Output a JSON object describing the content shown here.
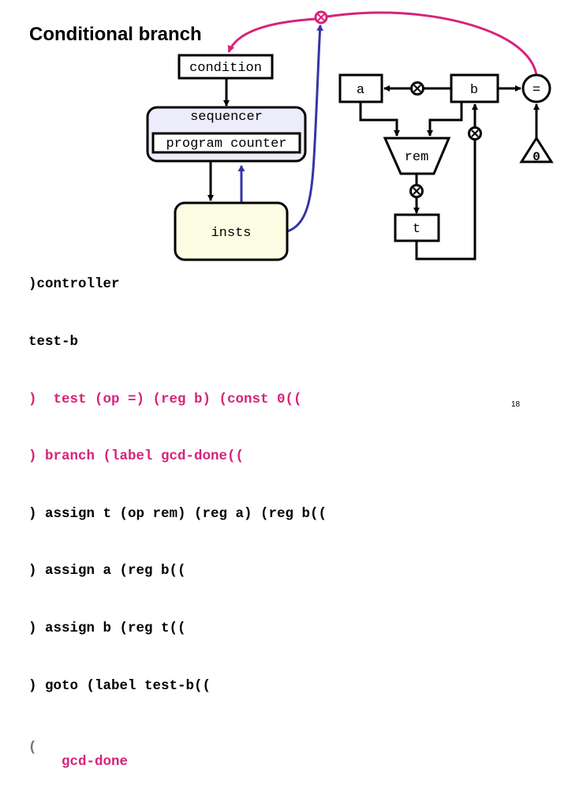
{
  "title": "Conditional branch",
  "diagram": {
    "nodes": {
      "condition": "condition",
      "sequencer": "sequencer",
      "program_counter": "program counter",
      "insts": "insts",
      "reg_a": "a",
      "reg_b": "b",
      "equals_op": "=",
      "rem_op": "rem",
      "reg_t": "t",
      "const_zero": "0"
    },
    "colors": {
      "branch_path": "#d6237a",
      "pc_path": "#3535a8",
      "sequencer_fill": "#ececfb",
      "insts_fill": "#fdfde3",
      "wire": "#000000"
    }
  },
  "code": {
    "lines": [
      {
        "text": ")controller",
        "highlight": false
      },
      {
        "text": "test-b",
        "highlight": false
      },
      {
        "text": ")  test (op =) (reg b) (const 0((",
        "highlight": true
      },
      {
        "text": ") branch (label gcd-done((",
        "highlight": true
      },
      {
        "text": ") assign t (op rem) (reg a) (reg b((",
        "highlight": false
      },
      {
        "text": ") assign a (reg b((",
        "highlight": false
      },
      {
        "text": ") assign b (reg t((",
        "highlight": false
      },
      {
        "text": ") goto (label test-b((",
        "highlight": false
      },
      {
        "text": "gcd-done",
        "highlight": true
      }
    ],
    "trailing_paren": "("
  },
  "page_number": "18"
}
